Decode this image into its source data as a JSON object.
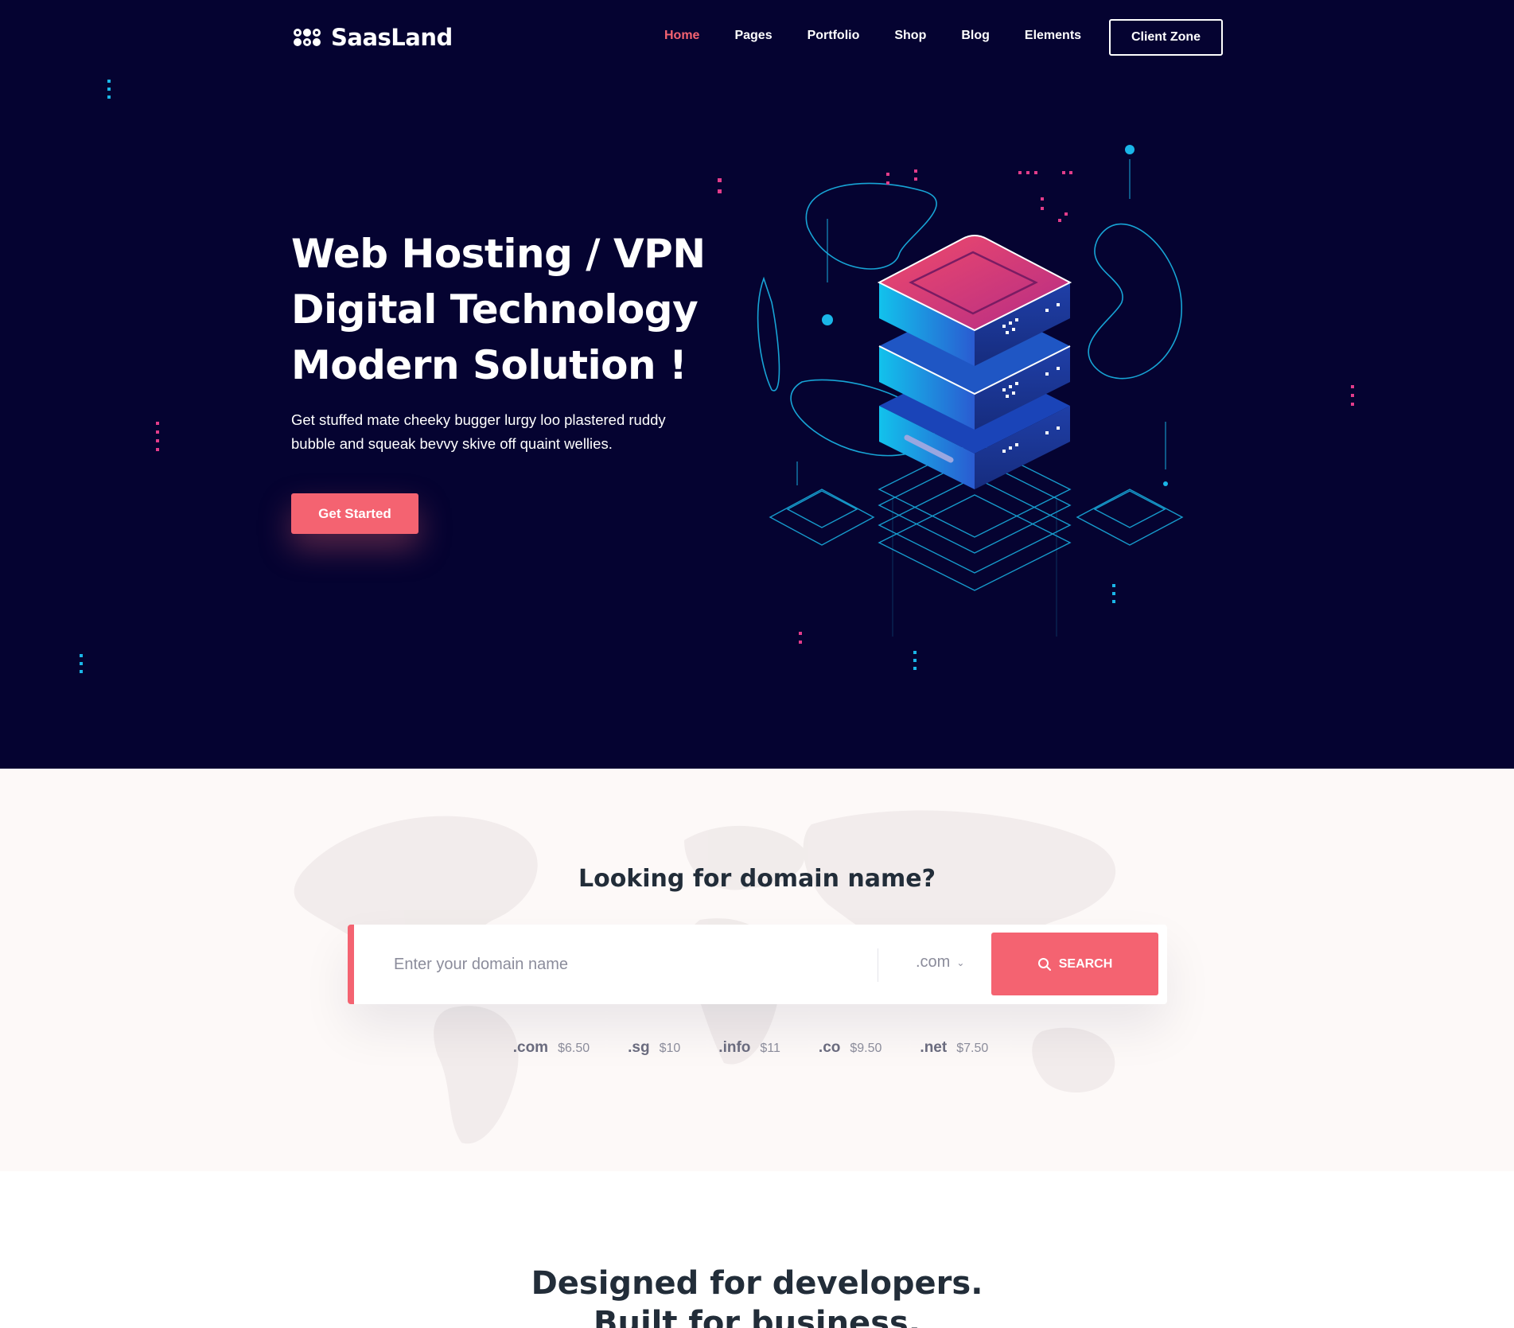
{
  "brand": {
    "name": "SaasLand"
  },
  "nav": {
    "items": [
      {
        "label": "Home",
        "active": true
      },
      {
        "label": "Pages"
      },
      {
        "label": "Portfolio"
      },
      {
        "label": "Shop"
      },
      {
        "label": "Blog"
      },
      {
        "label": "Elements"
      }
    ],
    "client_zone_label": "Client Zone"
  },
  "hero": {
    "title_lines": [
      "Web Hosting / VPN",
      "Digital Technology",
      "Modern Solution !"
    ],
    "description_lines": [
      "Get stuffed mate cheeky bugger lurgy loo plastered ruddy",
      "bubble and squeak bevvy skive off quaint wellies."
    ],
    "cta_label": "Get Started"
  },
  "domain_search": {
    "title": "Looking for domain name?",
    "placeholder": "Enter your domain name",
    "selected_tld": ".com",
    "button_label": "SEARCH",
    "prices": [
      {
        "tld": ".com",
        "price": "$6.50"
      },
      {
        "tld": ".sg",
        "price": "$10"
      },
      {
        "tld": ".info",
        "price": "$11"
      },
      {
        "tld": ".co",
        "price": "$9.50"
      },
      {
        "tld": ".net",
        "price": "$7.50"
      }
    ]
  },
  "developers": {
    "title_lines": [
      "Designed for developers.",
      "Built for business."
    ]
  },
  "colors": {
    "hero_bg": "#050331",
    "accent": "#f46371",
    "cyan": "#1ab6e8",
    "magenta": "#e23c8a",
    "heading_dark": "#222d39",
    "domain_bg": "#fdf9f8"
  },
  "icons": {
    "logo": "saasland-logo-icon",
    "search": "search-icon",
    "chevron": "chevron-down-icon"
  }
}
